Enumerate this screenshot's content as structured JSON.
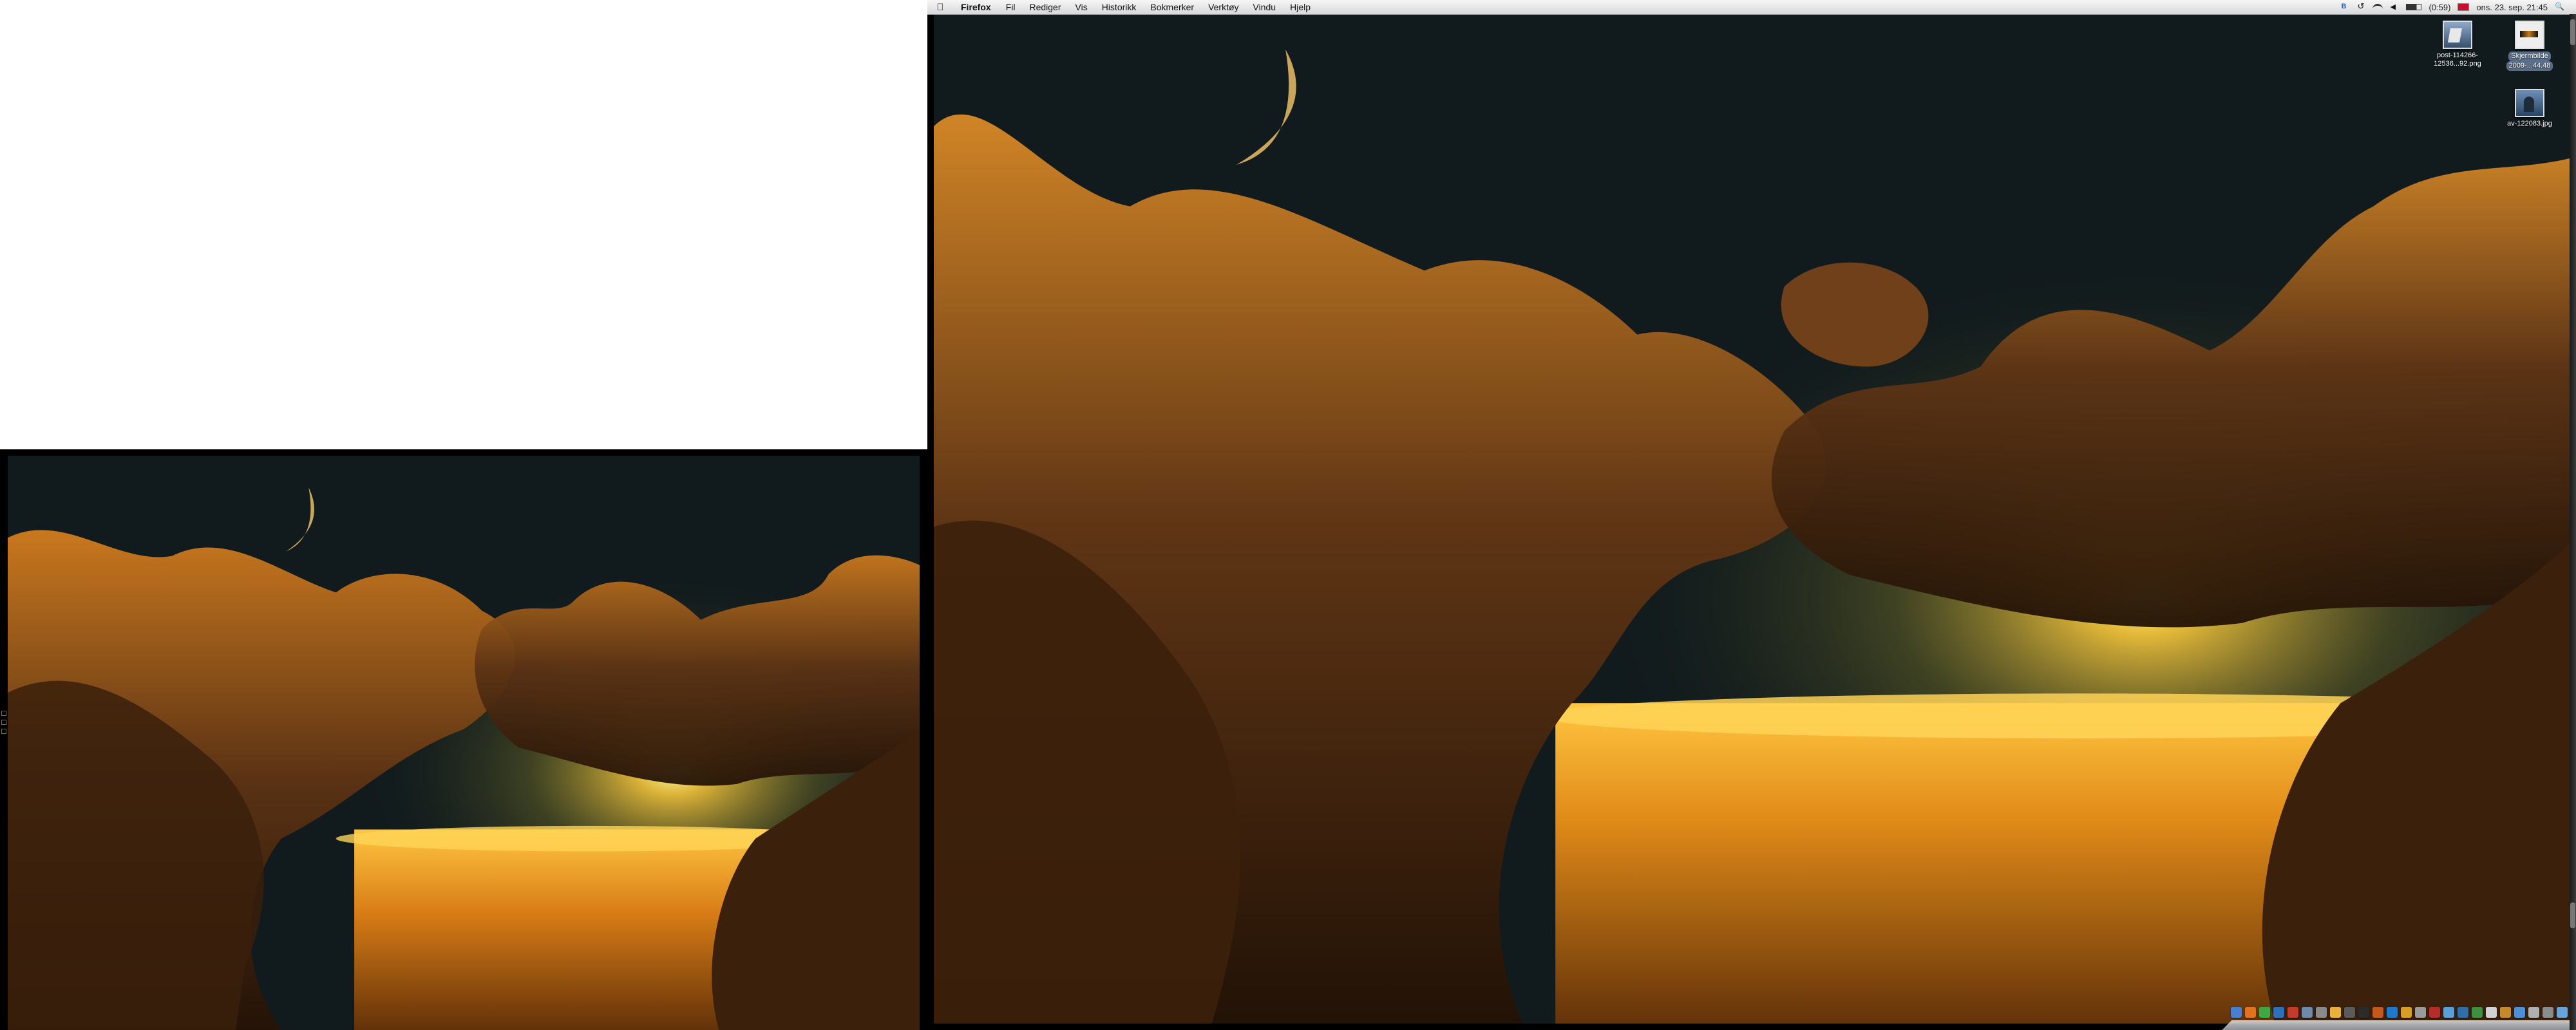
{
  "menubar": {
    "apple_icon": "apple-icon",
    "app_name": "Firefox",
    "menus": [
      "Fil",
      "Rediger",
      "Vis",
      "Historikk",
      "Bokmerker",
      "Verktøy",
      "Vindu",
      "Hjelp"
    ],
    "battery_text": "(0:59)",
    "clock": "ons. 23. sep.  21:45"
  },
  "desktop_icons": [
    {
      "name": "post-114266-12536...92.png",
      "line1": "post-114266-",
      "line2": "12536...92.png"
    },
    {
      "name": "Skjermbilde 2009-...44.48",
      "line1": "Skjermbilde",
      "line2": "2009-...44.48",
      "selected": true
    },
    {
      "name": "av-122083.jpg",
      "line1": "av-122083.jpg",
      "line2": ""
    }
  ],
  "wallpaper": {
    "subject": "sunset above clouds with crescent moon",
    "sky_color": "#111a1d",
    "cloud_color": "#c9781e",
    "glow_color": "#ffd64a"
  },
  "dock": {
    "tile_colors": [
      "#4a7fd0",
      "#e0731f",
      "#3da844",
      "#2d6fb8",
      "#c23b2b",
      "#6e8aa8",
      "#8a8a8a",
      "#e8b23a",
      "#5b5b5b",
      "#2b2b2b",
      "#c15a1c",
      "#1f78c9",
      "#d8a022",
      "#9a9a9a",
      "#b32d2d",
      "#5aa0d8",
      "#2f6ea8",
      "#3e8f3e",
      "#d2d2d2",
      "#c78a2a",
      "#4f8fd8",
      "#b0b0b0",
      "#8c8c8c",
      "#6aa3d8",
      "#5f5f5f",
      "#dcdcdc",
      "#e6e6e6",
      "#a8a8a8",
      "#c6c6c6",
      "#7a7a7a",
      "#e0e0e0",
      "#9c9c9c"
    ]
  }
}
